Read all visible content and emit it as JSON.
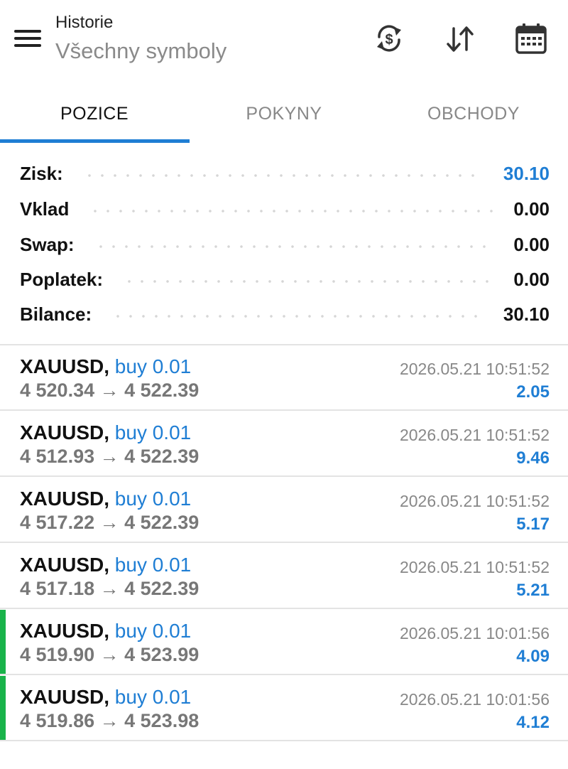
{
  "header": {
    "title": "Historie",
    "subtitle": "Všechny symboly",
    "icons": [
      "menu-icon",
      "currency-sync-icon",
      "sort-icon",
      "calendar-icon"
    ]
  },
  "tabs": [
    {
      "label": "POZICE",
      "active": true
    },
    {
      "label": "POKYNY",
      "active": false
    },
    {
      "label": "OBCHODY",
      "active": false
    }
  ],
  "summary": [
    {
      "label": "Zisk:",
      "value": "30.10",
      "accent": true
    },
    {
      "label": "Vklad",
      "value": "0.00",
      "accent": false
    },
    {
      "label": "Swap:",
      "value": "0.00",
      "accent": false
    },
    {
      "label": "Poplatek:",
      "value": "0.00",
      "accent": false
    },
    {
      "label": "Bilance:",
      "value": "30.10",
      "accent": false
    }
  ],
  "deals": [
    {
      "symbol": "XAUUSD,",
      "side": "buy 0.01",
      "open": "4 520.34",
      "arrow": "→",
      "close": "4 522.39",
      "time": "2026.05.21 10:51:52",
      "profit": "2.05",
      "marked": false
    },
    {
      "symbol": "XAUUSD,",
      "side": "buy 0.01",
      "open": "4 512.93",
      "arrow": "→",
      "close": "4 522.39",
      "time": "2026.05.21 10:51:52",
      "profit": "9.46",
      "marked": false
    },
    {
      "symbol": "XAUUSD,",
      "side": "buy 0.01",
      "open": "4 517.22",
      "arrow": "→",
      "close": "4 522.39",
      "time": "2026.05.21 10:51:52",
      "profit": "5.17",
      "marked": false
    },
    {
      "symbol": "XAUUSD,",
      "side": "buy 0.01",
      "open": "4 517.18",
      "arrow": "→",
      "close": "4 522.39",
      "time": "2026.05.21 10:51:52",
      "profit": "5.21",
      "marked": false
    },
    {
      "symbol": "XAUUSD,",
      "side": "buy 0.01",
      "open": "4 519.90",
      "arrow": "→",
      "close": "4 523.99",
      "time": "2026.05.21 10:01:56",
      "profit": "4.09",
      "marked": true
    },
    {
      "symbol": "XAUUSD,",
      "side": "buy 0.01",
      "open": "4 519.86",
      "arrow": "→",
      "close": "4 523.98",
      "time": "2026.05.21 10:01:56",
      "profit": "4.12",
      "marked": true
    }
  ],
  "colors": {
    "accent": "#1f7ed4",
    "marker": "#19b34a",
    "muted": "#888888"
  }
}
